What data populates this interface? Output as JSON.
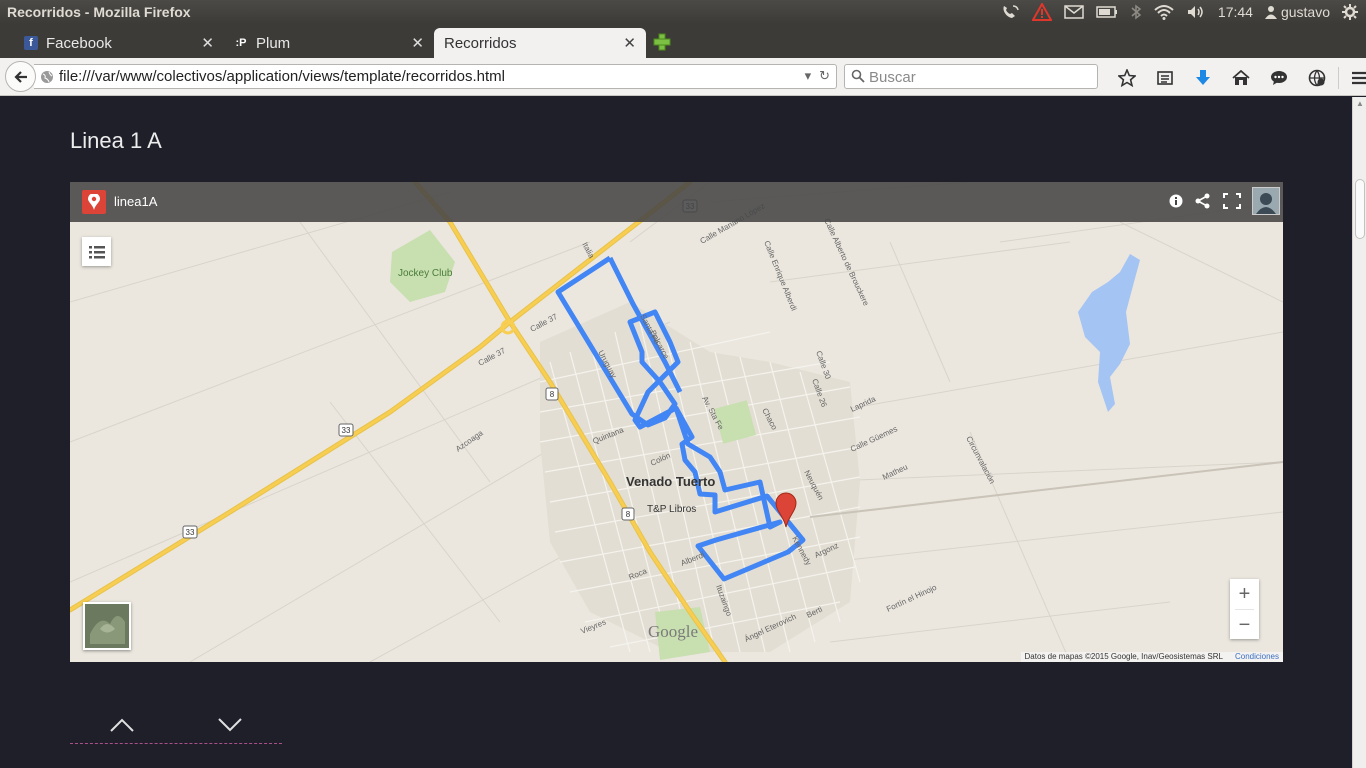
{
  "window": {
    "title": "Recorridos - Mozilla Firefox"
  },
  "tray": {
    "clock": "17:44",
    "user": "gustavo"
  },
  "tabs": [
    {
      "label": "Facebook",
      "favicon": "facebook-icon"
    },
    {
      "label": "Plum",
      "favicon": "plum-icon"
    },
    {
      "label": "Recorridos",
      "active": true
    }
  ],
  "nav": {
    "url": "file:///var/www/colectivos/application/views/template/recorridos.html",
    "search_placeholder": "Buscar"
  },
  "page": {
    "title": "Linea 1 A"
  },
  "map": {
    "name": "linea1A",
    "city_label": "Venado Tuerto",
    "poi_labels": [
      "Jockey Club",
      "T&P Libros"
    ],
    "street_labels": [
      "Italia",
      "Calle Mariano López",
      "Calle Enrique Alberdi",
      "Calle Alberto de Brouckere",
      "Calle 37",
      "Santa Fe",
      "Balcarce",
      "Uruguay",
      "Calle 30",
      "Calle 26",
      "Laprida",
      "Chaco",
      "Av. Sta Fe",
      "Quintana",
      "Colón",
      "Azcoaga",
      "Calle Güemes",
      "Matheu",
      "Circunvalación",
      "Neuquén",
      "Kennedy",
      "Argonz",
      "Alberdi",
      "Roca",
      "Vieyres",
      "Ituzaingo",
      "Ángel Eterovich",
      "Berti",
      "Fortín el Hinojo"
    ],
    "route_badges": [
      "33",
      "8"
    ],
    "attribution": "Datos de mapas ©2015 Google, Inav/Geosistemas SRL",
    "terms": "Condiciones",
    "google_logo": "Google",
    "zoom_in": "+",
    "zoom_out": "−"
  },
  "colors": {
    "route": "#4285f4",
    "highway": "#f7ce52",
    "lake": "#a4c4f4",
    "pin": "#db4437",
    "page_bg": "#1e1f29"
  }
}
